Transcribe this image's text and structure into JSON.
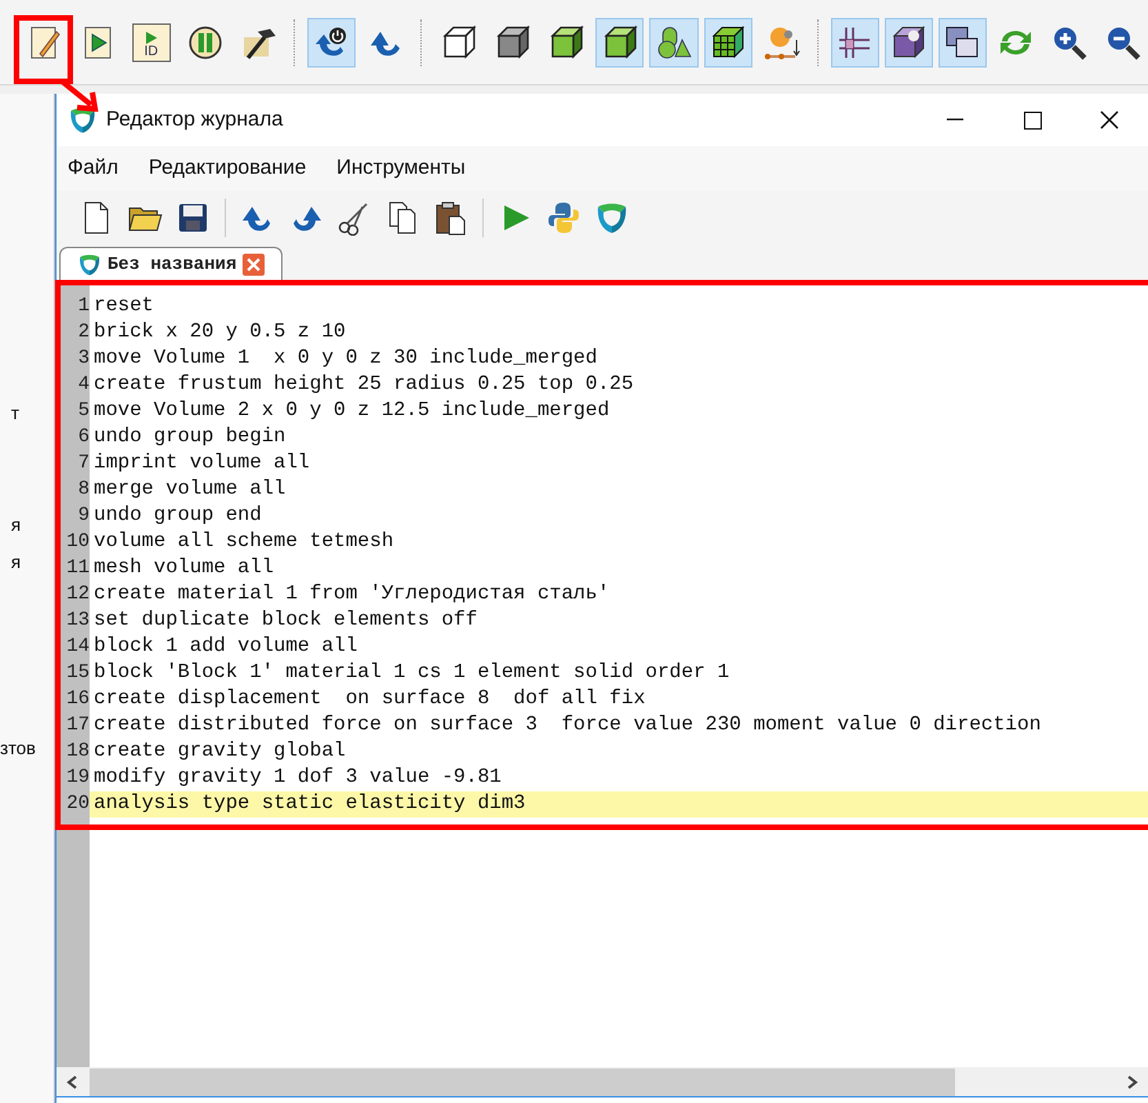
{
  "main_toolbar": [
    {
      "kind": "note",
      "selected": false
    },
    {
      "kind": "play",
      "selected": false
    },
    {
      "kind": "play-id",
      "label": "ID",
      "selected": false
    },
    {
      "kind": "pause",
      "selected": false
    },
    {
      "kind": "hammer",
      "selected": false
    },
    {
      "kind": "separator"
    },
    {
      "kind": "power-undo",
      "selected": true
    },
    {
      "kind": "undo",
      "selected": false
    },
    {
      "kind": "separator"
    },
    {
      "kind": "wire-cube",
      "selected": false
    },
    {
      "kind": "gray-cube",
      "selected": false
    },
    {
      "kind": "green-cube",
      "selected": false
    },
    {
      "kind": "green-cube",
      "selected": true
    },
    {
      "kind": "shapes",
      "selected": true
    },
    {
      "kind": "mesh-cube",
      "selected": true
    },
    {
      "kind": "node",
      "selected": false
    },
    {
      "kind": "separator"
    },
    {
      "kind": "grid",
      "selected": true
    },
    {
      "kind": "purple-cube",
      "selected": true
    },
    {
      "kind": "windows",
      "selected": true
    },
    {
      "kind": "refresh",
      "selected": false
    },
    {
      "kind": "zoom-in",
      "selected": false
    },
    {
      "kind": "zoom-out",
      "selected": false
    }
  ],
  "background_window": {
    "fragments": [
      "т",
      "я",
      "я",
      "зтов"
    ]
  },
  "dialog": {
    "title": "Редактор журнала",
    "menu": [
      "Файл",
      "Редактирование",
      "Инструменты"
    ],
    "toolbar": [
      {
        "kind": "new"
      },
      {
        "kind": "open"
      },
      {
        "kind": "save"
      },
      {
        "kind": "separator"
      },
      {
        "kind": "undo"
      },
      {
        "kind": "redo"
      },
      {
        "kind": "cut"
      },
      {
        "kind": "copy"
      },
      {
        "kind": "paste"
      },
      {
        "kind": "separator"
      },
      {
        "kind": "run"
      },
      {
        "kind": "python"
      },
      {
        "kind": "logo"
      }
    ],
    "tabs": [
      {
        "label": "Без названия",
        "selected": true
      }
    ],
    "lines": [
      {
        "number": "1",
        "text": "reset",
        "current": false
      },
      {
        "number": "2",
        "text": "brick x 20 y 0.5 z 10",
        "current": false
      },
      {
        "number": "3",
        "text": "move Volume 1  x 0 y 0 z 30 include_merged",
        "current": false
      },
      {
        "number": "4",
        "text": "create frustum height 25 radius 0.25 top 0.25",
        "current": false
      },
      {
        "number": "5",
        "text": "move Volume 2 x 0 y 0 z 12.5 include_merged",
        "current": false
      },
      {
        "number": "6",
        "text": "undo group begin",
        "current": false
      },
      {
        "number": "7",
        "text": "imprint volume all",
        "current": false
      },
      {
        "number": "8",
        "text": "merge volume all",
        "current": false
      },
      {
        "number": "9",
        "text": "undo group end",
        "current": false
      },
      {
        "number": "10",
        "text": "volume all scheme tetmesh",
        "current": false
      },
      {
        "number": "11",
        "text": "mesh volume all",
        "current": false
      },
      {
        "number": "12",
        "text": "create material 1 from 'Углеродистая сталь'",
        "current": false
      },
      {
        "number": "13",
        "text": "set duplicate block elements off",
        "current": false
      },
      {
        "number": "14",
        "text": "block 1 add volume all",
        "current": false
      },
      {
        "number": "15",
        "text": "block 'Block 1' material 1 cs 1 element solid order 1",
        "current": false
      },
      {
        "number": "16",
        "text": "create displacement  on surface 8  dof all fix",
        "current": false
      },
      {
        "number": "17",
        "text": "create distributed force on surface 3  force value 230 moment value 0 direction",
        "current": false
      },
      {
        "number": "18",
        "text": "create gravity global",
        "current": false
      },
      {
        "number": "19",
        "text": "modify gravity 1 dof 3 value -9.81",
        "current": false
      },
      {
        "number": "20",
        "text": "analysis type static elasticity dim3",
        "current": true
      }
    ]
  }
}
